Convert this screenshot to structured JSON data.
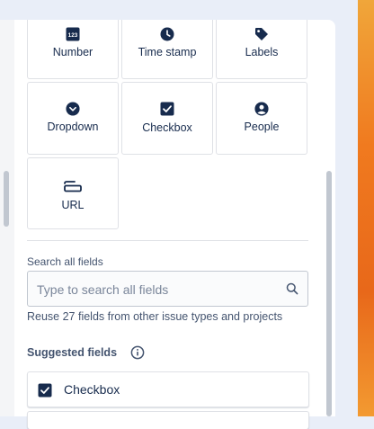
{
  "field_types": [
    {
      "label": "Number",
      "icon": "number-icon"
    },
    {
      "label": "Time stamp",
      "icon": "clock-icon"
    },
    {
      "label": "Labels",
      "icon": "tag-icon"
    },
    {
      "label": "Dropdown",
      "icon": "chevron-down-circle-icon"
    },
    {
      "label": "Checkbox",
      "icon": "checkbox-icon"
    },
    {
      "label": "People",
      "icon": "person-circle-icon"
    },
    {
      "label": "URL",
      "icon": "link-icon"
    }
  ],
  "number_icon_text": "123",
  "search": {
    "label": "Search all fields",
    "placeholder": "Type to search all fields",
    "value": "",
    "helper": "Reuse 27 fields from other issue types and projects"
  },
  "suggested": {
    "heading": "Suggested fields",
    "items": [
      {
        "label": "Checkbox",
        "icon": "checkbox-icon"
      }
    ]
  },
  "colors": {
    "text": "#172b4d",
    "icon": "#172b4d",
    "border": "#dfe1e6",
    "muted": "#44546f",
    "accent_strip": "#f07a1f"
  }
}
